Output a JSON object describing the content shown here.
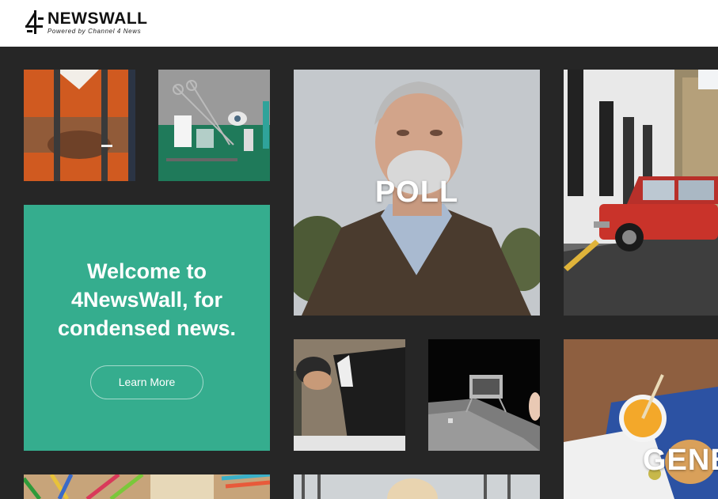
{
  "brand": {
    "title": "NEWSWALL",
    "subtitle": "Powered by Channel 4 News"
  },
  "welcome": {
    "line1": "Welcome to",
    "line2": "4NewsWall, for",
    "line3": "condensed news.",
    "button_label": "Learn More"
  },
  "tiles": {
    "poll_label": "POLL",
    "general_label": "GENE"
  },
  "colors": {
    "accent": "#35ad8e",
    "background": "#262626",
    "header": "#ffffff"
  }
}
